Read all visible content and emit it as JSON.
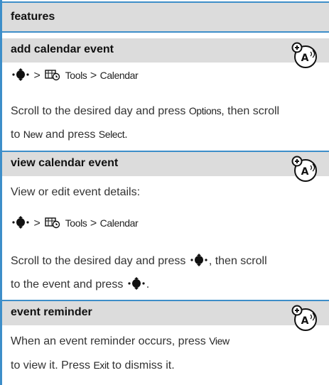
{
  "header": {
    "title": "features"
  },
  "nav_path": {
    "gt": ">",
    "tools": "Tools",
    "calendar": "Calendar"
  },
  "sections": [
    {
      "title": "add calendar event",
      "body_1a": "Scroll to the desired day and press ",
      "body_1b": "Options",
      "body_1c": ", then scroll",
      "body_2a": "to ",
      "body_2b": "New",
      "body_2c": " and press ",
      "body_2d": "Select",
      "body_2e": "."
    },
    {
      "title": "view calendar event",
      "intro": "View or edit event details:",
      "body_1a": "Scroll to the desired day and press ",
      "body_1b": ", then scroll",
      "body_2a": "to the event and press ",
      "body_2b": "."
    },
    {
      "title": "event reminder",
      "body_1a": "When an event reminder occurs, press ",
      "body_1b": "View",
      "body_2a": "to view it. Press ",
      "body_2b": "Exit",
      "body_2c": " to dismiss it."
    }
  ],
  "badge_icon": "network-operator-feature-icon",
  "colors": {
    "accent": "#3d8ec9",
    "band": "#dcdcdc"
  }
}
